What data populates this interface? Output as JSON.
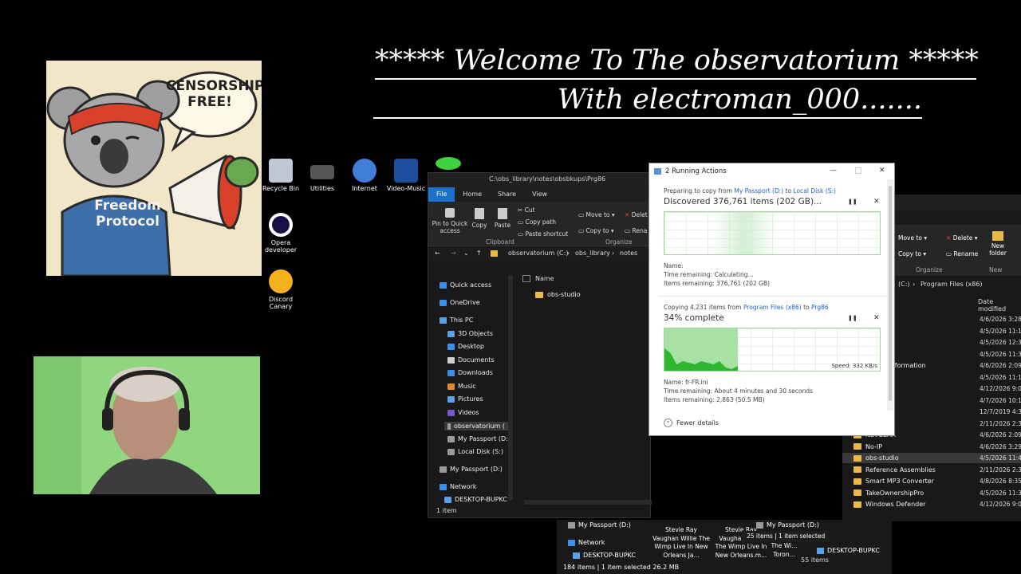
{
  "banner": {
    "line1": "***** Welcome To The observatorium *****",
    "line2": "With electroman_000......."
  },
  "poster": {
    "bubble": "CENSORSHIP FREE!",
    "shirt": "Freedom Protocol"
  },
  "desktop_icons": [
    {
      "label": "Recycle Bin",
      "icon": "recycle-bin-icon",
      "color": "#bfc8d6"
    },
    {
      "label": "Utilities",
      "icon": "utilities-icon",
      "color": "#666666"
    },
    {
      "label": "Internet",
      "icon": "internet-globe-icon",
      "color": "#3f7fd8"
    },
    {
      "label": "Video-Music",
      "icon": "film-strip-icon",
      "color": "#1d4f9c"
    },
    {
      "label": "Opera developer",
      "icon": "opera-icon",
      "color": "#1a1048"
    },
    {
      "label": "Discord Canary",
      "icon": "discord-icon",
      "color": "#f3b21b"
    }
  ],
  "explorer_left": {
    "path": "C:\\obs_library\\notes\\obsbkups\\Prg86",
    "tabs": [
      "File",
      "Home",
      "Share",
      "View"
    ],
    "ribbon": {
      "pin": "Pin to Quick access",
      "copy": "Copy",
      "paste": "Paste",
      "cut": "Cut",
      "copy_path": "Copy path",
      "paste_shortcut": "Paste shortcut",
      "move_to": "Move to",
      "copy_to": "Copy to",
      "delete": "Delet",
      "rename": "Rena",
      "clipboard": "Clipboard",
      "organize": "Organize"
    },
    "breadcrumb": [
      "observatorium (C:)",
      "obs_library",
      "notes"
    ],
    "column_name": "Name",
    "files": [
      "obs-studio"
    ],
    "nav": [
      {
        "label": "Quick access",
        "color": "#3b8fe8"
      },
      {
        "label": "OneDrive",
        "color": "#3b8fe8"
      },
      {
        "label": "This PC",
        "color": "#5aa0e8"
      },
      {
        "label": "3D Objects",
        "color": "#5aa0e8"
      },
      {
        "label": "Desktop",
        "color": "#3b8fe8"
      },
      {
        "label": "Documents",
        "color": "#cfcfcf"
      },
      {
        "label": "Downloads",
        "color": "#3b8fe8"
      },
      {
        "label": "Music",
        "color": "#e58a2b"
      },
      {
        "label": "Pictures",
        "color": "#5aa0e8"
      },
      {
        "label": "Videos",
        "color": "#7a56c8"
      },
      {
        "label": "observatorium (",
        "color": "#9a9a9a"
      },
      {
        "label": "My Passport (D:)",
        "color": "#9a9a9a"
      },
      {
        "label": "Local Disk (S:)",
        "color": "#9a9a9a"
      },
      {
        "label": "My Passport (D:)",
        "color": "#9a9a9a"
      },
      {
        "label": "Network",
        "color": "#3b8fe8"
      },
      {
        "label": "DESKTOP-BUPKC",
        "color": "#5aa0e8"
      }
    ],
    "status": "1 item"
  },
  "dialog": {
    "title": "2 Running Actions",
    "op1": {
      "prefix": "Preparing to copy from",
      "from": "My Passport (D:)",
      "mid": "to",
      "to": "Local Disk (S:)",
      "heading": "Discovered 376,761 items (202 GB)...",
      "name": "Name:",
      "time": "Time remaining:  Calculating...",
      "items": "Items remaining:  376,761 (202 GB)"
    },
    "op2": {
      "prefix": "Copying 4,231 items from",
      "from": "Program Files (x86)",
      "mid": "to",
      "to": "Prg86",
      "heading": "34% complete",
      "progress": 0.34,
      "speed": "Speed: 332 KB/s",
      "name": "Name:  fr-FR.ini",
      "time": "Time remaining:  About 4 minutes and 30 seconds",
      "items": "Items remaining:  2,863 (50.5 MB)"
    },
    "fewer": "Fewer details",
    "pause_glyph": "❚❚",
    "close_glyph": "✕",
    "min_glyph": "—",
    "fewer_glyph": "⌃"
  },
  "explorer_right": {
    "ribbon": {
      "move_to": "Move to",
      "copy_to": "Copy to",
      "delete": "Delete",
      "rename": "Rename",
      "new_folder": "New folder",
      "organize": "Organize",
      "new": "New"
    },
    "breadcrumb": [
      "(C:)",
      "Program Files (x86)"
    ],
    "column_date": "Date modified",
    "rows": [
      {
        "name": "",
        "date": "4/6/2026 3:28"
      },
      {
        "name": "",
        "date": "4/5/2026 11:1"
      },
      {
        "name": "",
        "date": "4/5/2026 12:3"
      },
      {
        "name": "",
        "date": "4/5/2026 11:3"
      },
      {
        "name": "nstallation information",
        "date": "4/6/2026 2:09"
      },
      {
        "name": "",
        "date": "4/5/2026 11:1"
      },
      {
        "name": "er",
        "date": "4/12/2026 9:0"
      },
      {
        "name": "",
        "date": "4/7/2026 10:1"
      },
      {
        "name": "",
        "date": "12/7/2019 4:3"
      },
      {
        "name": "",
        "date": "2/11/2026 2:3"
      },
      {
        "name": "NETGEAR",
        "date": "4/6/2026 2:09"
      },
      {
        "name": "No-IP",
        "date": "4/6/2026 3:29"
      },
      {
        "name": "obs-studio",
        "date": "4/5/2026 11:4"
      },
      {
        "name": "Reference Assemblies",
        "date": "2/11/2026 2:3"
      },
      {
        "name": "Smart MP3 Converter",
        "date": "4/8/2026 8:35"
      },
      {
        "name": "TakeOwnershipPro",
        "date": "4/5/2026 11:3"
      },
      {
        "name": "Windows Defender",
        "date": "4/12/2026 9:0"
      }
    ]
  },
  "bottom_strip": {
    "nav": [
      "My Passport (D:)",
      "Network",
      "DESKTOP-BUPKC"
    ],
    "nav2": [
      "My Passport (D:)",
      "DESKTOP-BUPKC"
    ],
    "thumbs": [
      "Stevie Ray Vaughan Willie The Wimp Live In New Orleans Ja...",
      "Stevie Ray Vaughan Willie The Wimp Live In New Orleans.m...",
      "The Wi... Toron..."
    ],
    "status1": "184 items",
    "status1_sel": "1 item selected  26.2 MB",
    "status2": "25 items",
    "status2_sel": "1 item selected",
    "status3": "55 items"
  }
}
